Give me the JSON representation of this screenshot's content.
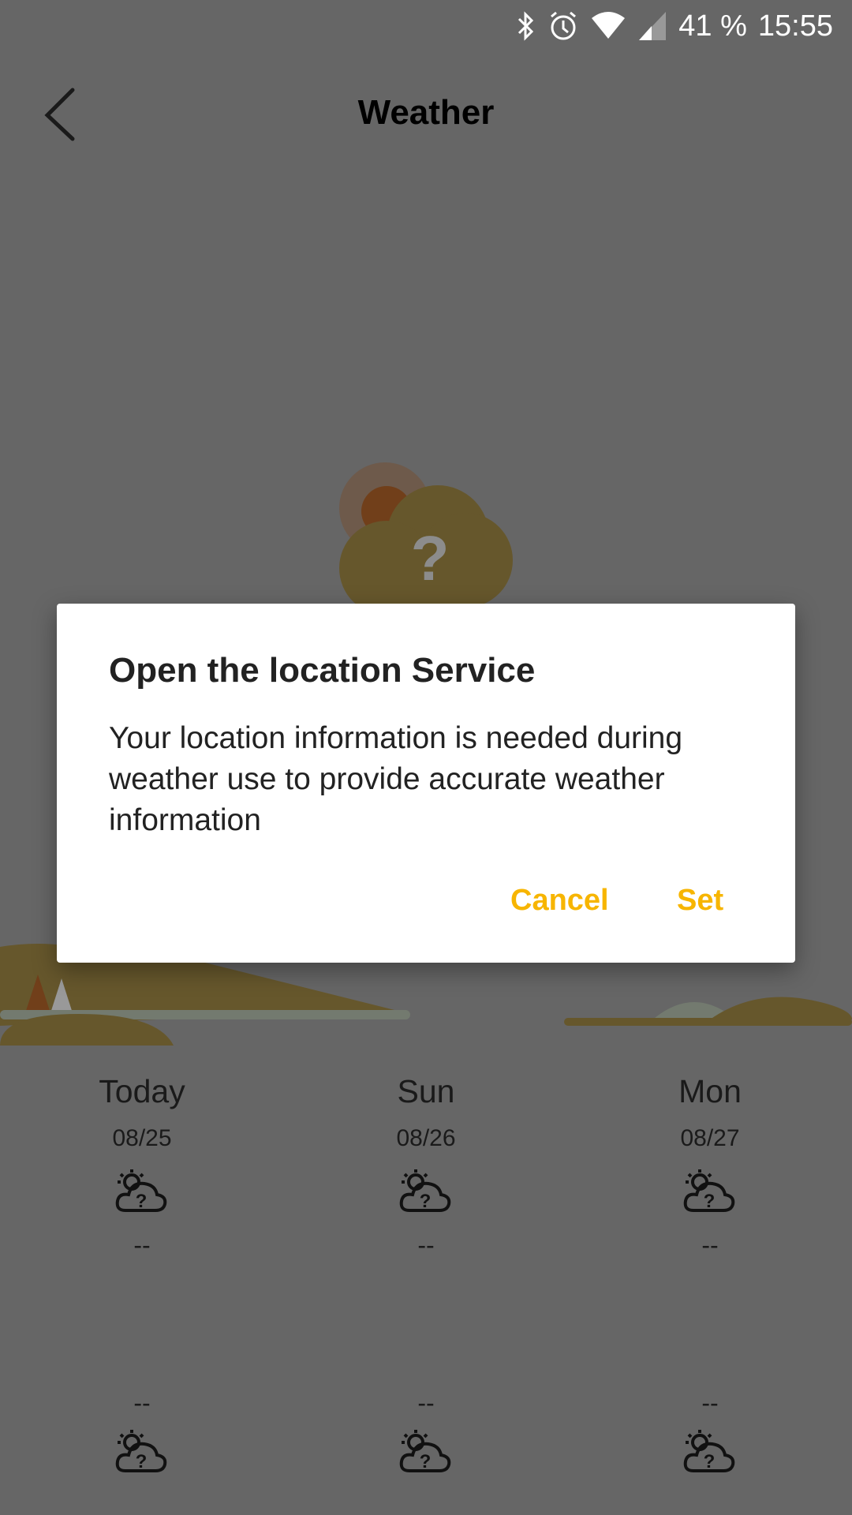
{
  "status_bar": {
    "battery": "41 %",
    "time": "15:55",
    "icons": [
      "bluetooth-icon",
      "alarm-icon",
      "wifi-icon",
      "signal-icon"
    ]
  },
  "header": {
    "title": "Weather",
    "back_icon": "chevron-left-icon"
  },
  "dialog": {
    "title": "Open the location Service",
    "body": "Your location information is needed during weather use to provide accurate weather information",
    "cancel_label": "Cancel",
    "set_label": "Set",
    "accent": "#f7b500"
  },
  "forecast": [
    {
      "day": "Today",
      "date": "08/25",
      "high": "--",
      "low": "--",
      "icon": "unknown-weather-icon"
    },
    {
      "day": "Sun",
      "date": "08/26",
      "high": "--",
      "low": "--",
      "icon": "unknown-weather-icon"
    },
    {
      "day": "Mon",
      "date": "08/27",
      "high": "--",
      "low": "--",
      "icon": "unknown-weather-icon"
    }
  ]
}
